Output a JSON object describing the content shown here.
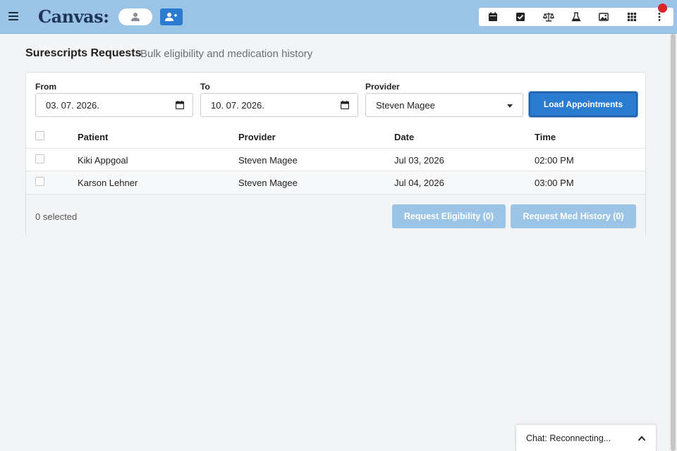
{
  "topbar": {
    "logo": "Canvas:",
    "tools": [
      {
        "icon": "calendar-icon"
      },
      {
        "icon": "checkbox-icon"
      },
      {
        "icon": "scales-icon"
      },
      {
        "icon": "flask-icon"
      },
      {
        "icon": "image-icon"
      },
      {
        "icon": "apps-grid-icon"
      },
      {
        "icon": "more-vertical-icon"
      }
    ],
    "notification_color": "#d9262c",
    "bar_color": "#9cc4e6"
  },
  "page": {
    "title": "Surescripts Requests",
    "subtitle": "Bulk eligibility and medication history"
  },
  "filters": {
    "from_label": "From",
    "from_value": "03. 07. 2026.",
    "to_label": "To",
    "to_value": "10. 07. 2026.",
    "provider_label": "Provider",
    "provider_value": "Steven Magee",
    "load_button": "Load Appointments"
  },
  "table": {
    "headers": {
      "patient": "Patient",
      "provider": "Provider",
      "date": "Date",
      "time": "Time"
    },
    "rows": [
      {
        "patient": "Kiki Appgoal",
        "provider": "Steven Magee",
        "date": "Jul 03, 2026",
        "time": "02:00 PM"
      },
      {
        "patient": "Karson Lehner",
        "provider": "Steven Magee",
        "date": "Jul 04, 2026",
        "time": "03:00 PM"
      }
    ]
  },
  "footer": {
    "selected_text": "0 selected",
    "eligibility_button": "Request Eligibility (0)",
    "med_history_button": "Request Med History (0)"
  },
  "chat": {
    "label": "Chat: Reconnecting..."
  },
  "colors": {
    "primary": "#2b7bd1",
    "disabled": "#9bc4e6"
  }
}
